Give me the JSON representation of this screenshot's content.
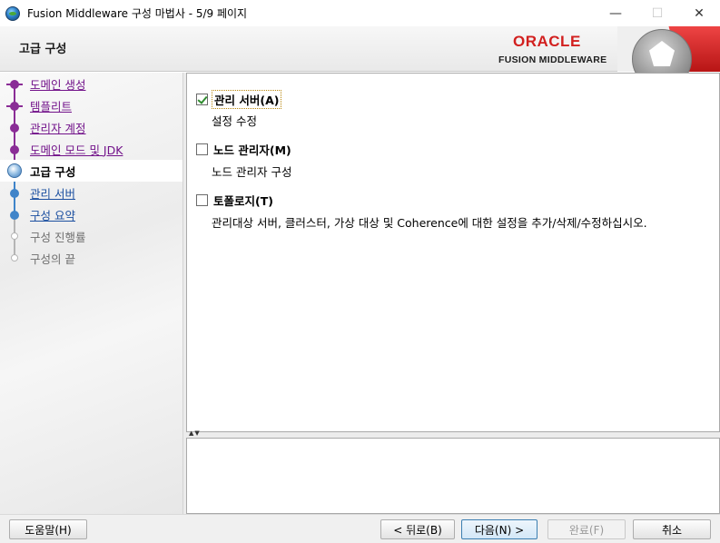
{
  "window": {
    "title": "Fusion Middleware 구성 마법사 - 5/9 페이지",
    "min_label": "—",
    "max_label": "☐",
    "close_label": "✕"
  },
  "header": {
    "title": "고급 구성",
    "brand_oracle": "ORACLE",
    "brand_product": "FUSION MIDDLEWARE",
    "brand_color": "#d2201f"
  },
  "nav": {
    "items": [
      {
        "label": "도메인 생성",
        "state": "visited"
      },
      {
        "label": "템플리트",
        "state": "visited"
      },
      {
        "label": "관리자 계정",
        "state": "visited"
      },
      {
        "label": "도메인 모드 및 JDK",
        "state": "visited"
      },
      {
        "label": "고급 구성",
        "state": "current"
      },
      {
        "label": "관리 서버",
        "state": "enabled"
      },
      {
        "label": "구성 요약",
        "state": "enabled"
      },
      {
        "label": "구성 진행률",
        "state": "future"
      },
      {
        "label": "구성의 끝",
        "state": "future"
      }
    ]
  },
  "options": [
    {
      "label": "관리 서버(A)",
      "description": "설정 수정",
      "checked": true
    },
    {
      "label": "노드 관리자(M)",
      "description": "노드 관리자 구성",
      "checked": false
    },
    {
      "label": "토폴로지(T)",
      "description": "관리대상 서버, 클러스터, 가상 대상 및 Coherence에 대한 설정을 추가/삭제/수정하십시오.",
      "checked": false
    }
  ],
  "footer": {
    "help_label": "도움말(H)",
    "back_label": "< 뒤로(B)",
    "next_label": "다음(N) >",
    "finish_label": "완료(F)",
    "cancel_label": "취소"
  }
}
